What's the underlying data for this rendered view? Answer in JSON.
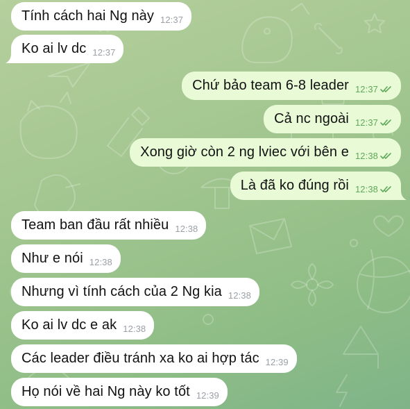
{
  "colors": {
    "chat_background": "#a3c690",
    "incoming_bubble": "#ffffff",
    "outgoing_bubble": "#e9fbd6",
    "incoming_time": "#9aa0a6",
    "outgoing_time_and_checks": "#5fa85a"
  },
  "messages": [
    {
      "direction": "incoming",
      "text": "Tính cách hai Ng này",
      "time": "12:37"
    },
    {
      "direction": "incoming",
      "text": "Ko ai lv dc",
      "time": "12:37"
    },
    {
      "direction": "outgoing",
      "text": "Chứ bảo team 6-8 leader",
      "time": "12:37",
      "status_icon": "double-check-read-icon"
    },
    {
      "direction": "outgoing",
      "text": "Cả nc ngoài",
      "time": "12:37",
      "status_icon": "double-check-read-icon"
    },
    {
      "direction": "outgoing",
      "text": "Xong giờ còn 2 ng lviec với bên e",
      "time": "12:38",
      "status_icon": "double-check-read-icon"
    },
    {
      "direction": "outgoing",
      "text": "Là đã ko đúng rồi",
      "time": "12:38",
      "status_icon": "double-check-read-icon"
    },
    {
      "direction": "incoming",
      "text": "Team ban đầu rất nhiều",
      "time": "12:38"
    },
    {
      "direction": "incoming",
      "text": "Như e nói",
      "time": "12:38"
    },
    {
      "direction": "incoming",
      "text": "Nhưng vì tính cách của 2 Ng kia",
      "time": "12:38"
    },
    {
      "direction": "incoming",
      "text": "Ko ai lv dc e ak",
      "time": "12:38"
    },
    {
      "direction": "incoming",
      "text": "Các leader điều tránh xa ko ai hợp tác",
      "time": "12:39"
    },
    {
      "direction": "incoming",
      "text": "Họ nói về hai Ng này ko tốt",
      "time": "12:39"
    }
  ]
}
